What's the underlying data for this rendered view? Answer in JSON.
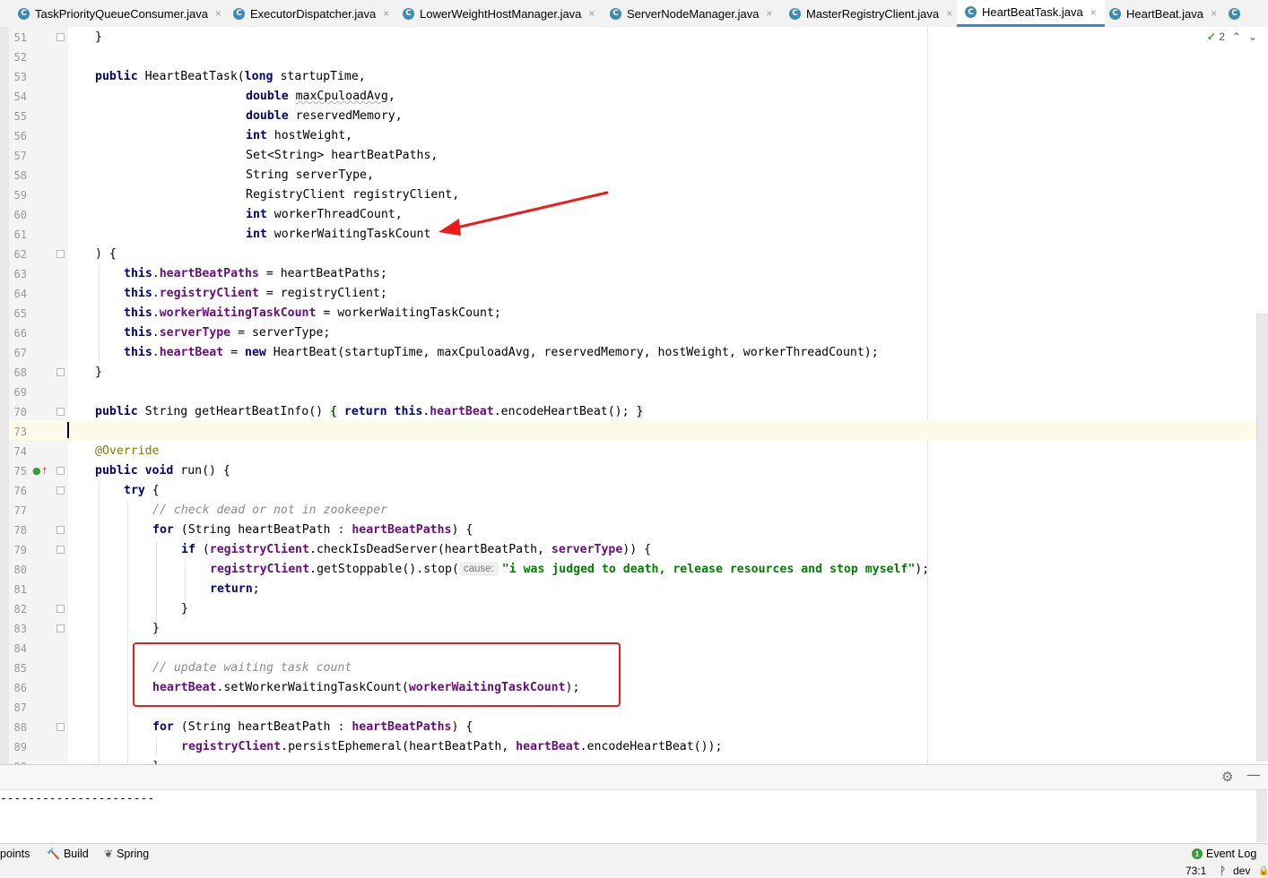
{
  "tabs": [
    {
      "name": "TaskPriorityQueueConsumer.java",
      "active": false
    },
    {
      "name": "ExecutorDispatcher.java",
      "active": false
    },
    {
      "name": "LowerWeightHostManager.java",
      "active": false
    },
    {
      "name": "ServerNodeManager.java",
      "active": false
    },
    {
      "name": "MasterRegistryClient.java",
      "active": false
    },
    {
      "name": "HeartBeatTask.java",
      "active": true
    },
    {
      "name": "HeartBeat.java",
      "active": false
    }
  ],
  "tab_icon_letter": "C",
  "tab_close_glyph": "×",
  "inspection": {
    "count": "2",
    "check": "✓",
    "prev": "⌃",
    "next": "⌄"
  },
  "lines": [
    {
      "n": "51",
      "fold": true
    },
    {
      "n": "52"
    },
    {
      "n": "53"
    },
    {
      "n": "54"
    },
    {
      "n": "55"
    },
    {
      "n": "56"
    },
    {
      "n": "57"
    },
    {
      "n": "58"
    },
    {
      "n": "59"
    },
    {
      "n": "60"
    },
    {
      "n": "61"
    },
    {
      "n": "62",
      "fold": true
    },
    {
      "n": "63"
    },
    {
      "n": "64"
    },
    {
      "n": "65"
    },
    {
      "n": "66"
    },
    {
      "n": "67"
    },
    {
      "n": "68",
      "fold": true
    },
    {
      "n": "69"
    },
    {
      "n": "70",
      "fold": true
    },
    {
      "n": "73"
    },
    {
      "n": "74"
    },
    {
      "n": "75",
      "fold": true,
      "marker": true
    },
    {
      "n": "76",
      "fold": true
    },
    {
      "n": "77"
    },
    {
      "n": "78",
      "fold": true
    },
    {
      "n": "79",
      "fold": true
    },
    {
      "n": "80"
    },
    {
      "n": "81"
    },
    {
      "n": "82",
      "fold": true
    },
    {
      "n": "83",
      "fold": true
    },
    {
      "n": "84"
    },
    {
      "n": "85"
    },
    {
      "n": "86"
    },
    {
      "n": "87"
    },
    {
      "n": "88",
      "fold": true
    },
    {
      "n": "89"
    },
    {
      "n": "90"
    }
  ],
  "code": {
    "l51_brace": "}",
    "l53_kw": "public",
    "l53_rest": " HeartBeatTask(",
    "l53_kw2": "long",
    "l53_rest2": " startupTime,",
    "l54_kw": "double",
    "l54_a": " ",
    "l54_param": "maxCpuloadAvg",
    "l54_b": ",",
    "l55_kw": "double",
    "l55_rest": " reservedMemory,",
    "l56_kw": "int",
    "l56_rest": " hostWeight,",
    "l57_text": "Set<String> heartBeatPaths,",
    "l58_text": "String serverType,",
    "l59_text": "RegistryClient registryClient,",
    "l60_kw": "int",
    "l60_rest": " workerThreadCount,",
    "l61_kw": "int",
    "l61_rest": " workerWaitingTaskCount",
    "l62_text": ") {",
    "this_kw": "this",
    "dot": ".",
    "l63_field": "heartBeatPaths",
    "l63_rest": " = heartBeatPaths;",
    "l64_field": "registryClient",
    "l64_rest": " = registryClient;",
    "l65_field": "workerWaitingTaskCount",
    "l65_rest": " = workerWaitingTaskCount;",
    "l66_field": "serverType",
    "l66_rest": " = serverType;",
    "l67_field": "heartBeat",
    "l67_a": " = ",
    "l67_new": "new",
    "l67_rest": " HeartBeat(startupTime, maxCpuloadAvg, reservedMemory, hostWeight, workerThreadCount);",
    "l68_brace": "}",
    "l70_kw": "public",
    "l70_a": " String getHeartBeatInfo() ",
    "l70_open": "{",
    "l70_sp": " ",
    "l70_return": "return",
    "l70_sp2": " ",
    "l70_this": "this",
    "l70_dot": ".",
    "l70_field": "heartBeat",
    "l70_rest": ".encodeHeartBeat(); ",
    "l70_close": "}",
    "l74_ann": "@Override",
    "l75_kw": "public",
    "l75_sp": " ",
    "l75_void": "void",
    "l75_rest": " run() {",
    "l76_try": "try",
    "l76_rest": " {",
    "l77_cmt": "// check dead or not in zookeeper",
    "l78_for": "for",
    "l78_a": " (String heartBeatPath : ",
    "l78_field": "heartBeatPaths",
    "l78_b": ") {",
    "l79_if": "if",
    "l79_a": " (",
    "l79_field": "registryClient",
    "l79_b": ".checkIsDeadServer(heartBeatPath, ",
    "l79_field2": "serverType",
    "l79_c": ")) {",
    "l80_field": "registryClient",
    "l80_a": ".getStoppable().stop(",
    "l80_hint": "cause:",
    "l80_str": "\"i was judged to death, release resources and stop myself\"",
    "l80_b": ");",
    "l81_return": "return",
    "l81_rest": ";",
    "l82_brace": "}",
    "l83_brace": "}",
    "l85_cmt": "// update waiting task count",
    "l86_field": "heartBeat",
    "l86_a": ".setWorkerWaitingTaskCount(",
    "l86_field2": "workerWaitingTaskCount",
    "l86_b": ");",
    "l88_for": "for",
    "l88_a": " (String heartBeatPath : ",
    "l88_field": "heartBeatPaths",
    "l88_b": ") {",
    "l89_field": "registryClient",
    "l89_a": ".persistEphemeral(heartBeatPath, ",
    "l89_field2": "heartBeat",
    "l89_b": ".encodeHeartBeat());",
    "l90_brace": "}"
  },
  "console": {
    "text": "----------------------"
  },
  "toolwin": {
    "gear": "⚙",
    "minimize": "—"
  },
  "tool_buttons": [
    {
      "label": "points",
      "icon": ""
    },
    {
      "label": "Build",
      "icon": "🔨"
    },
    {
      "label": "Spring",
      "icon": "❦"
    }
  ],
  "event_log": {
    "label": "Event Log",
    "badge": "1"
  },
  "status": {
    "position": "73:1",
    "branch_icon": "ᚹ",
    "branch": "dev",
    "lock_icon": "🔒"
  },
  "colors": {
    "keyword": "#000080",
    "field": "#660e7a",
    "string": "#008000",
    "comment": "#8c8c8c",
    "annotation": "#808000",
    "highlight": "#ee1b1b",
    "active_tab": "#4083c9"
  }
}
